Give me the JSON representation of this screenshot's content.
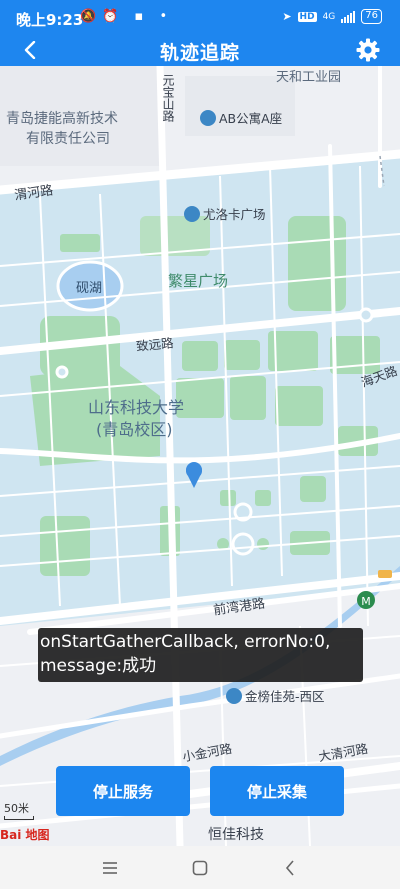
{
  "status_bar": {
    "time": "晚上9:23",
    "network": "HD",
    "signal": "4G",
    "battery": "76"
  },
  "app_bar": {
    "title": "轨迹追踪"
  },
  "map": {
    "labels": {
      "tianhe": "天和工业园",
      "yuanbao": "元宝山路",
      "jieneng_line1": "青岛捷能高新技术",
      "jieneng_line2": "有限责任公司",
      "ab_apartment": "AB公寓A座",
      "weihe_road": "渭河路",
      "youluoka": "尤洛卡广场",
      "yanhu": "砚湖",
      "fanxing": "繁星广场",
      "zhiyuan_road": "致远路",
      "haitian_road": "海天路",
      "sdust_line1": "山东科技大学",
      "sdust_line2": "(青岛校区)",
      "qianwan_road": "前湾港路",
      "jinbang": "金榜佳苑-西区",
      "xiaojinhe_road": "小金河路",
      "daqinghe_road": "大清河路",
      "hengjia": "恒佳科技"
    },
    "scale_label": "50米",
    "logo_text": "Bai 地图"
  },
  "toast": {
    "message": "onStartGatherCallback, errorNo:0, message:成功"
  },
  "buttons": {
    "stop_service": "停止服务",
    "stop_gather": "停止采集"
  },
  "colors": {
    "primary": "#1e86ef",
    "campus": "#cde4f1",
    "green": "#a9dbb5",
    "water": "#a8cef0"
  }
}
